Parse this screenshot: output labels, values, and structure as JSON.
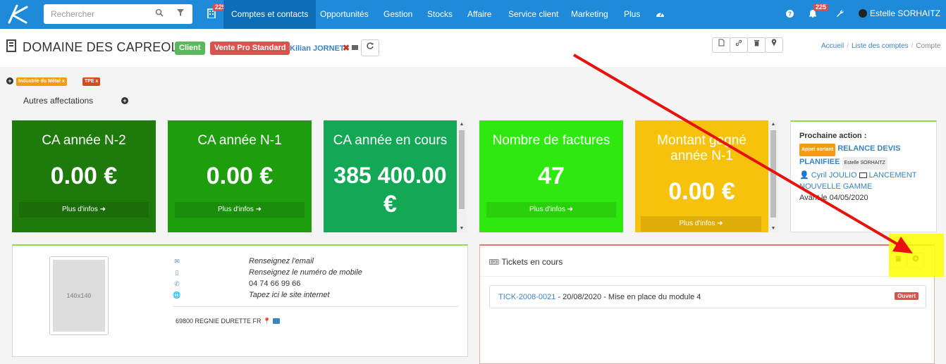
{
  "navbar": {
    "search_placeholder": "Rechercher",
    "notif_count_accounts": "225",
    "items": [
      {
        "label": "Comptes et contacts",
        "active": true
      },
      {
        "label": "Opportunités"
      },
      {
        "label": "Gestion"
      },
      {
        "label": "Stocks"
      },
      {
        "label": "Affaire"
      },
      {
        "label": "Service client"
      },
      {
        "label": "Marketing"
      },
      {
        "label": "Plus"
      }
    ],
    "notif_count_bell": "225",
    "user_name": "Estelle SORHAITZ"
  },
  "header": {
    "account_name": "DOMAINE DES CAPREOLES",
    "label_client": "Client",
    "label_sales": "Vente Pro Standard",
    "owner": "Kilian JORNET",
    "breadcrumb": [
      "Accueil",
      "Liste des comptes",
      "Compte"
    ]
  },
  "tags": {
    "items": [
      "Industrie du Métal x",
      "TPE x"
    ],
    "autres_affectations": "Autres affectations"
  },
  "kpis": [
    {
      "title": "CA année N-2",
      "value": "0.00 €",
      "more": "Plus d'infos",
      "color": "#1e7a0a"
    },
    {
      "title": "CA année N-1",
      "value": "0.00 €",
      "more": "Plus d'infos",
      "color": "#1e9d0d"
    },
    {
      "title": "CA année en cours",
      "value_line1": "385 400.00",
      "value_line2": "€",
      "color": "#12a856"
    },
    {
      "title": "Nombre de factures",
      "value": "47",
      "more": "Plus d'infos",
      "color": "#2fe80d"
    },
    {
      "title_line1": "Montant gagné",
      "title_line2": "année N-1",
      "value": "0.00 €",
      "more": "Plus d'infos",
      "color": "#f6c20c"
    }
  ],
  "next_action": {
    "title": "Prochaine action :",
    "type_badge": "Appel sortant",
    "subject_part1": "RELANCE DEVIS",
    "subject_part2": "PLANIFIEE",
    "assignee": "Estelle SORHAITZ",
    "contact": "Cyril JOULIO",
    "project_part1": "LANCEMENT",
    "project_part2": "NOUVELLE GAMME",
    "due": "Avant le 04/05/2020"
  },
  "contact": {
    "photo_placeholder": "140x140",
    "email": "Renseignez l'email",
    "mobile": "Renseignez le numéro de mobile",
    "phone": "04 74 66 99 66",
    "website": "Tapez ici le site internet",
    "address": "69800 REGNIE DURETTE FR"
  },
  "tickets": {
    "title": "Tickets en cours",
    "rows": [
      {
        "ref": "TICK-2008-0021",
        "rest": " - 20/08/2020 - Mise en place du module 4",
        "status": "Ouvert"
      }
    ]
  }
}
